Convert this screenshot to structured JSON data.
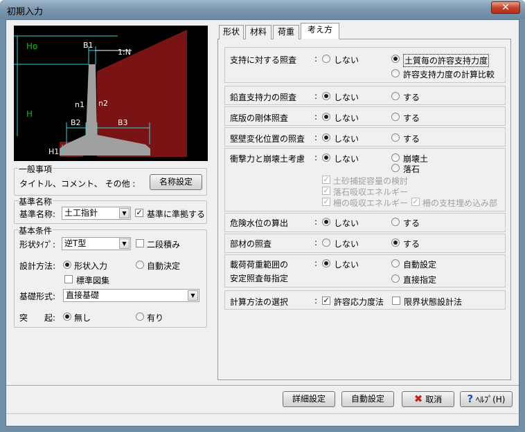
{
  "window": {
    "title": "初期入力",
    "close_glyph": "✕"
  },
  "diagram": {
    "labels": {
      "ho": "Ho",
      "b1": "B1",
      "slope": "1:N",
      "h": "H",
      "n1": "n1",
      "n2": "n2",
      "b2": "B2",
      "b3": "B3",
      "h1": "H1"
    },
    "colors": {
      "bg": "#000000",
      "fill": "#7a1414",
      "wall": "#a0a0a0",
      "dim": "#2fd6d6",
      "h_label": "#00c800",
      "text": "#ffffff"
    }
  },
  "general": {
    "legend": "一般事項",
    "text": "タイトル、コメント、 その他 :",
    "button": "名称設定"
  },
  "standard": {
    "legend": "基準名称",
    "label": "基準名称:",
    "value": "土工指針",
    "check_label": "基準に準拠する",
    "checked": true
  },
  "basic": {
    "legend": "基本条件",
    "shape_label": "形状ﾀｲﾌﾟ:",
    "shape_value": "逆T型",
    "two_stage": "二段積み",
    "design_label": "設計方法:",
    "design_opt1": "形状入力",
    "design_opt2": "自動決定",
    "std_fig": "標準図集",
    "found_label": "基礎形式:",
    "found_value": "直接基礎",
    "proj_label": "突　　起:",
    "proj_opt1": "無し",
    "proj_opt2": "有り"
  },
  "tabs": [
    "形状",
    "材料",
    "荷重",
    "考え方"
  ],
  "rows": {
    "support": {
      "label": "支持に対する照査",
      "colon": ":",
      "opt1": "しない",
      "opt2": "土質毎の許容支持力度",
      "opt3": "許容支持力度の計算比較"
    },
    "vertical": {
      "label": "鉛直支持力の照査",
      "colon": ":",
      "opt1": "しない",
      "opt2": "する"
    },
    "rigid": {
      "label": "底版の剛体照査",
      "colon": ":",
      "opt1": "しない",
      "opt2": "する"
    },
    "wallchange": {
      "label": "堅壁変化位置の照査",
      "colon": ":",
      "opt1": "しない",
      "opt2": "する"
    },
    "impact": {
      "label": "衝撃力と崩壊土考慮",
      "colon": ":",
      "opt1": "しない",
      "opt2": "崩壊土",
      "opt3": "落石",
      "sub1": "土砂捕捉容量の検討",
      "sub2": "落石吸収エネルギー",
      "sub3": "柵の吸収エネルギー",
      "sub4": "柵の支柱埋め込み部"
    },
    "danger": {
      "label": "危険水位の算出",
      "colon": ":",
      "opt1": "しない",
      "opt2": "する"
    },
    "member": {
      "label": "部材の照査",
      "colon": ":",
      "opt1": "しない",
      "opt2": "する"
    },
    "loadrange": {
      "label1": "載荷荷重範囲の",
      "label2": "安定照査毎指定",
      "colon": ":",
      "opt1": "しない",
      "opt2": "自動設定",
      "opt3": "直接指定"
    },
    "calc": {
      "label": "計算方法の選択",
      "colon": ":",
      "opt1": "許容応力度法",
      "opt2": "限界状態設計法"
    }
  },
  "footer": {
    "detail": "詳細設定",
    "auto": "自動設定",
    "cancel": "取消",
    "help": "ﾍﾙﾌﾟ(H)"
  }
}
